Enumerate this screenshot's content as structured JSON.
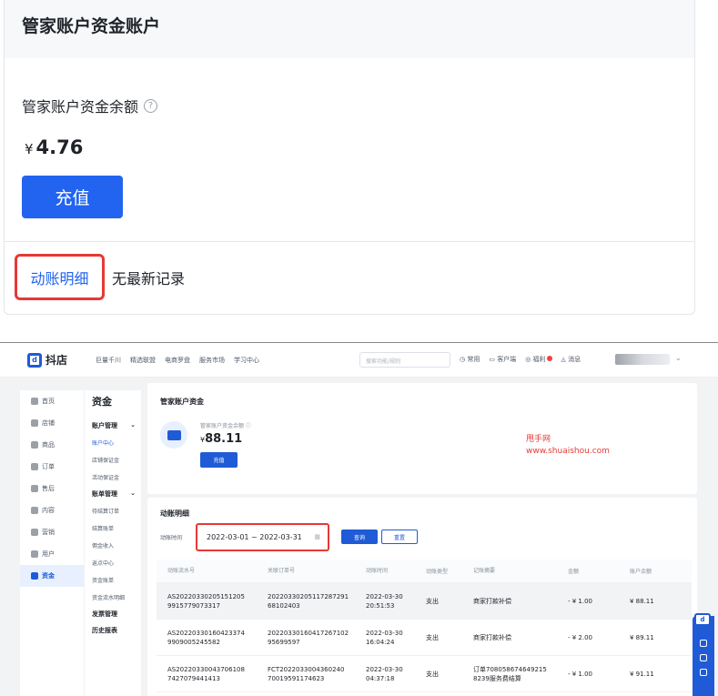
{
  "top": {
    "title": "管家账户资金账户",
    "balance_label": "管家账户资金余额",
    "help_glyph": "?",
    "currency": "¥",
    "balance": "4.76",
    "recharge_label": "充值",
    "detail_link": "动账明细",
    "no_record": "无最新记录"
  },
  "app": {
    "logo_text": "抖店",
    "logo_glyph": "d",
    "nav": [
      "巨量千川",
      "精选联盟",
      "电商罗盘",
      "服务市场",
      "学习中心"
    ],
    "search_placeholder": "搜索功能/规则",
    "top_right": [
      "常用",
      "客户端",
      "福利",
      "消息"
    ],
    "sidebar": [
      "首页",
      "店铺",
      "商品",
      "订单",
      "售后",
      "内容",
      "营销",
      "用户",
      "资金"
    ],
    "subnav": {
      "title": "资金",
      "group1": "账户管理",
      "group1_items": [
        "账户中心",
        "店铺保证金",
        "活动保证金"
      ],
      "group2": "账单管理",
      "group2_items": [
        "待结算订单",
        "结算账单",
        "佣金收入",
        "返点中心",
        "资金账单",
        "资金流水明细"
      ],
      "group3": "发票管理",
      "group4": "历史报表"
    },
    "card1": {
      "title": "管家账户资金",
      "balance_label": "管家账户资金余额 ⓘ",
      "currency": "¥",
      "balance": "88.11",
      "recharge_label": "充值"
    },
    "watermark": [
      "甩手网",
      "www.shuaishou.com"
    ],
    "card2": {
      "title": "动账明细",
      "date_label": "动账时间",
      "date_range": "2022-03-01 ~ 2022-03-31",
      "query_label": "查询",
      "reset_label": "重置",
      "columns": [
        "动账流水号",
        "关联订单号",
        "动账时间",
        "动账类型",
        "记账摘要",
        "金额",
        "账户余额"
      ],
      "rows": [
        {
          "serial": [
            "AS20220330205151205",
            "9915779073317"
          ],
          "order": [
            "20220330205117287291",
            "68102403"
          ],
          "time": [
            "2022-03-30",
            "20:51:53"
          ],
          "type": "支出",
          "summary": [
            "商家打款补偿"
          ],
          "amount": "- ¥ 1.00",
          "balance": "¥ 88.11"
        },
        {
          "serial": [
            "AS20220330160423374",
            "9909005245582"
          ],
          "order": [
            "20220330160417267102",
            "95699597"
          ],
          "time": [
            "2022-03-30",
            "16:04:24"
          ],
          "type": "支出",
          "summary": [
            "商家打款补偿"
          ],
          "amount": "- ¥ 2.00",
          "balance": "¥ 89.11"
        },
        {
          "serial": [
            "AS20220330043706108",
            "7427079441413"
          ],
          "order": [
            "FCT2022033004360240",
            "70019591174623"
          ],
          "time": [
            "2022-03-30",
            "04:37:18"
          ],
          "type": "支出",
          "summary": [
            "订单708058674649215",
            "8239服务费结算"
          ],
          "amount": "- ¥ 1.00",
          "balance": "¥ 91.11"
        }
      ]
    }
  }
}
